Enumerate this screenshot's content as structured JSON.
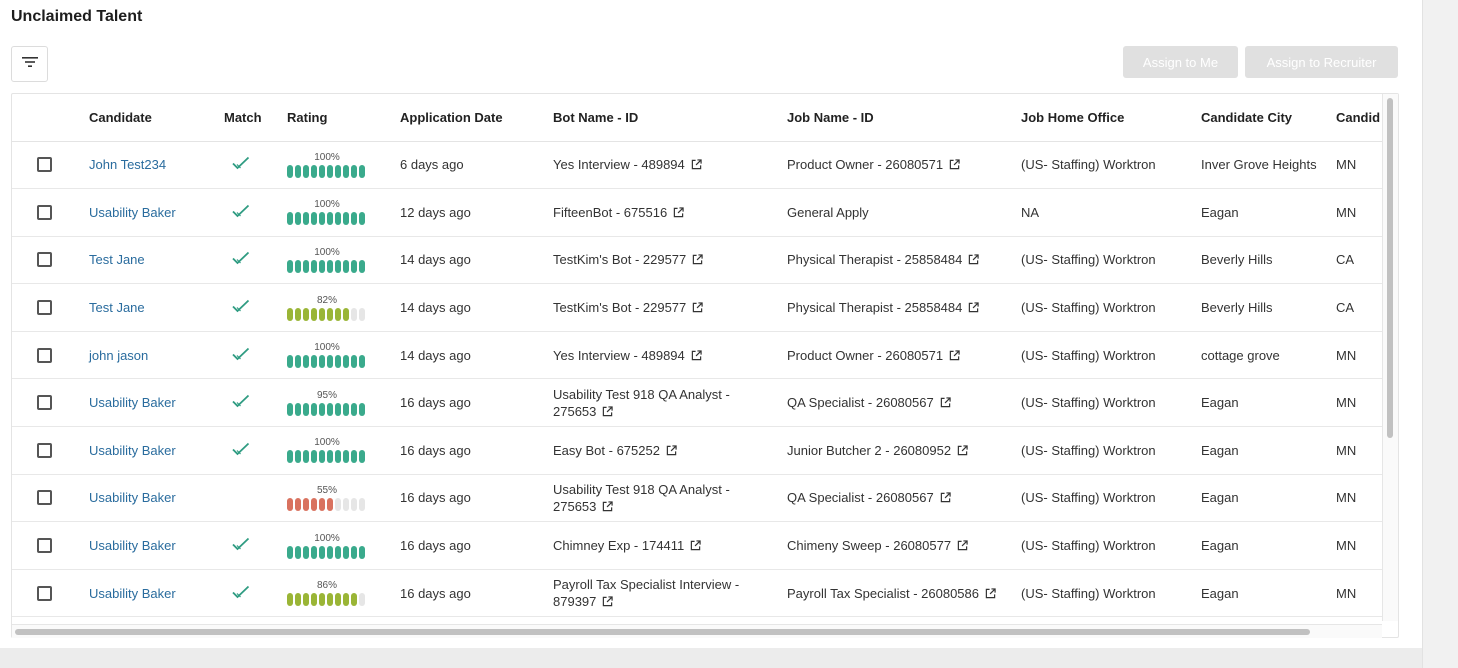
{
  "page": {
    "title": "Unclaimed Talent"
  },
  "toolbar": {
    "filter_icon": "filter-icon",
    "assign_to_me": "Assign to Me",
    "assign_to_recruiter": "Assign to Recruiter"
  },
  "table": {
    "headers": [
      "Candidate",
      "Match",
      "Rating",
      "Application Date",
      "Bot Name - ID",
      "Job Name - ID",
      "Job Home Office",
      "Candidate City",
      "Candid"
    ],
    "rows": [
      {
        "candidate": "John Test234",
        "match": true,
        "rating": "100%",
        "rating_value": 100,
        "rating_color": "#3aaa8c",
        "date": "6 days ago",
        "bot": "Yes Interview - 489894",
        "bot_link": true,
        "job": "Product Owner - 26080571",
        "job_link": true,
        "office": "(US- Staffing) Worktron",
        "city": "Inver Grove Heights",
        "state": "MN"
      },
      {
        "candidate": "Usability Baker",
        "match": true,
        "rating": "100%",
        "rating_value": 100,
        "rating_color": "#3aaa8c",
        "date": "12 days ago",
        "bot": "FifteenBot - 675516",
        "bot_link": true,
        "job": "General Apply",
        "job_link": false,
        "office": "NA",
        "city": "Eagan",
        "state": "MN"
      },
      {
        "candidate": "Test Jane",
        "match": true,
        "rating": "100%",
        "rating_value": 100,
        "rating_color": "#3aaa8c",
        "date": "14 days ago",
        "bot": "TestKim's Bot - 229577",
        "bot_link": true,
        "job": "Physical Therapist - 25858484",
        "job_link": true,
        "office": "(US- Staffing) Worktron",
        "city": "Beverly Hills",
        "state": "CA"
      },
      {
        "candidate": "Test Jane",
        "match": true,
        "rating": "82%",
        "rating_value": 82,
        "rating_color": "#9ab536",
        "date": "14 days ago",
        "bot": "TestKim's Bot - 229577",
        "bot_link": true,
        "job": "Physical Therapist - 25858484",
        "job_link": true,
        "office": "(US- Staffing) Worktron",
        "city": "Beverly Hills",
        "state": "CA"
      },
      {
        "candidate": "john jason",
        "match": true,
        "rating": "100%",
        "rating_value": 100,
        "rating_color": "#3aaa8c",
        "date": "14 days ago",
        "bot": "Yes Interview - 489894",
        "bot_link": true,
        "job": "Product Owner - 26080571",
        "job_link": true,
        "office": "(US- Staffing) Worktron",
        "city": "cottage grove",
        "state": "MN"
      },
      {
        "candidate": "Usability Baker",
        "match": true,
        "rating": "95%",
        "rating_value": 95,
        "rating_color": "#3aaa8c",
        "date": "16 days ago",
        "bot": "Usability Test 918 QA Analyst - 275653",
        "bot_link": true,
        "job": "QA Specialist - 26080567",
        "job_link": true,
        "office": "(US- Staffing) Worktron",
        "city": "Eagan",
        "state": "MN"
      },
      {
        "candidate": "Usability Baker",
        "match": true,
        "rating": "100%",
        "rating_value": 100,
        "rating_color": "#3aaa8c",
        "date": "16 days ago",
        "bot": "Easy Bot - 675252",
        "bot_link": true,
        "job": "Junior Butcher 2 - 26080952",
        "job_link": true,
        "office": "(US- Staffing) Worktron",
        "city": "Eagan",
        "state": "MN"
      },
      {
        "candidate": "Usability Baker",
        "match": false,
        "rating": "55%",
        "rating_value": 55,
        "rating_color": "#d9725f",
        "date": "16 days ago",
        "bot": "Usability Test 918 QA Analyst - 275653",
        "bot_link": true,
        "job": "QA Specialist - 26080567",
        "job_link": true,
        "office": "(US- Staffing) Worktron",
        "city": "Eagan",
        "state": "MN"
      },
      {
        "candidate": "Usability Baker",
        "match": true,
        "rating": "100%",
        "rating_value": 100,
        "rating_color": "#3aaa8c",
        "date": "16 days ago",
        "bot": "Chimney Exp - 174411",
        "bot_link": true,
        "job": "Chimeny Sweep - 26080577",
        "job_link": true,
        "office": "(US- Staffing) Worktron",
        "city": "Eagan",
        "state": "MN"
      },
      {
        "candidate": "Usability Baker",
        "match": true,
        "rating": "86%",
        "rating_value": 86,
        "rating_color": "#9ab536",
        "date": "16 days ago",
        "bot": "Payroll Tax Specialist Interview - 879397",
        "bot_link": true,
        "job": "Payroll Tax Specialist - 26080586",
        "job_link": true,
        "office": "(US- Staffing) Worktron",
        "city": "Eagan",
        "state": "MN"
      }
    ]
  },
  "colors": {
    "link": "#2a6c9e",
    "check": "#2f9c82",
    "button_disabled": "#e0e0e0"
  }
}
